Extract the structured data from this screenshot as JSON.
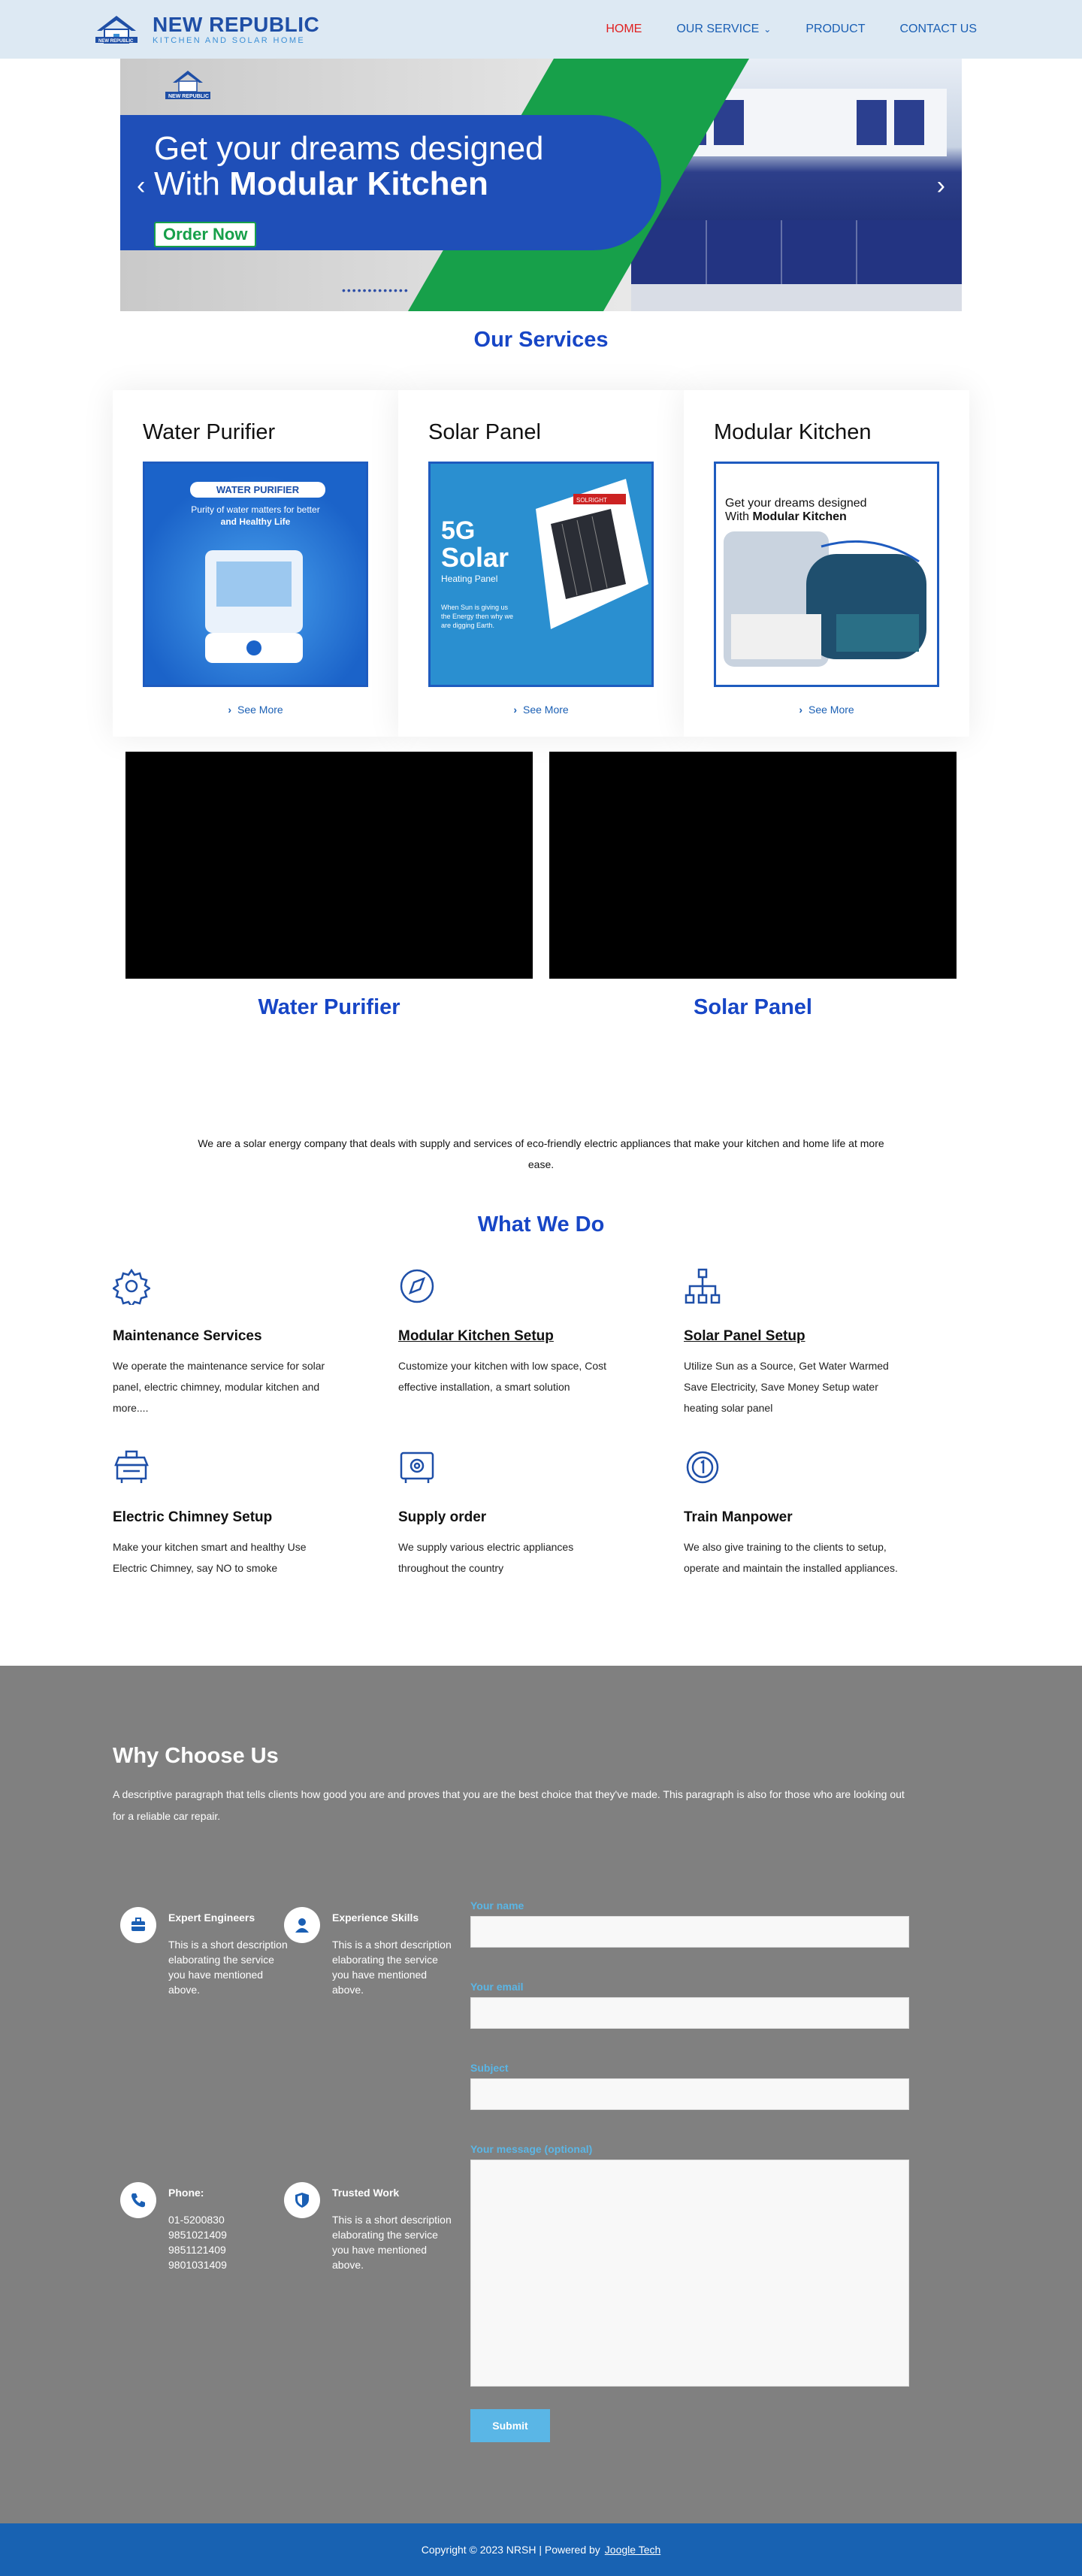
{
  "header": {
    "brand_title": "NEW REPUBLIC",
    "brand_sub": "KITCHEN AND SOLAR HOME",
    "nav": [
      {
        "label": "HOME",
        "active": true
      },
      {
        "label": "OUR SERVICE",
        "dropdown": true
      },
      {
        "label": "PRODUCT"
      },
      {
        "label": "CONTACT US"
      }
    ]
  },
  "banner": {
    "line1": "Get your dreams designed",
    "line2_prefix": "With ",
    "line2_bold": "Modular Kitchen",
    "cta": "Order Now",
    "logo_title": "NEW REPUBLIC",
    "prev_icon": "chevron-left-icon",
    "next_icon": "chevron-right-icon"
  },
  "services": {
    "title": "Our Services",
    "cards": [
      {
        "title": "Water Purifier",
        "see_more": "See More",
        "img_badge": "WATER PURIFIER",
        "img_line1": "Purity of water matters for better",
        "img_line2": "and Healthy Life"
      },
      {
        "title": "Solar Panel",
        "see_more": "See More",
        "img_big": "5G",
        "img_big2": "Solar",
        "img_sub": "Heating Panel",
        "img_note": "When Sun is giving us the Energy then why we are digging Earth.",
        "img_brand": "SOLRIGHT"
      },
      {
        "title": "Modular Kitchen",
        "see_more": "See More",
        "img_line1": "Get your dreams designed",
        "img_line2_prefix": "With ",
        "img_line2_bold": "Modular Kitchen"
      }
    ]
  },
  "videos": {
    "labels": [
      "Water Purifier",
      "Solar Panel"
    ]
  },
  "about": "We are a solar energy company that deals with supply and services of eco-friendly electric appliances that make your kitchen and home life at more ease.",
  "what_we_do": {
    "title": "What We Do",
    "items": [
      {
        "icon": "gear-icon",
        "title": "Maintenance Services",
        "underline": false,
        "text": "We operate the maintenance service for solar panel, electric chimney, modular kitchen and more...."
      },
      {
        "icon": "compass-icon",
        "title": "Modular Kitchen Setup",
        "underline": true,
        "text": "Customize your kitchen with low space, Cost effective installation, a smart solution"
      },
      {
        "icon": "sitemap-icon",
        "title": "Solar Panel Setup",
        "underline": true,
        "text": "Utilize Sun as a Source, Get Water Warmed Save Electricity, Save Money Setup water heating solar panel"
      },
      {
        "icon": "chimney-icon",
        "title": "Electric Chimney Setup",
        "underline": false,
        "text": "Make your kitchen smart and healthy Use Electric Chimney, say NO to smoke"
      },
      {
        "icon": "safe-icon",
        "title": "Supply order",
        "underline": false,
        "text": "We supply various electric appliances throughout the country"
      },
      {
        "icon": "coin-icon",
        "title": "Train Manpower",
        "underline": false,
        "text": "We also give training to the clients to setup, operate and maintain the installed appliances."
      }
    ]
  },
  "why": {
    "title": "Why Choose Us",
    "desc": "A descriptive paragraph that tells clients how good you are and proves that you are the best choice that they've made. This paragraph is also for those who are looking out for a reliable car repair.",
    "features": [
      {
        "icon": "briefcase-icon",
        "title": "Expert Engineers",
        "text": "This is a short description elaborating the service you have mentioned above."
      },
      {
        "icon": "user-icon",
        "title": "Experience Skills",
        "text": "This is a short description elaborating the service you have mentioned above."
      },
      {
        "icon": "phone-icon",
        "title": "Phone:",
        "text": "01-5200830\n9851021409\n9851121409\n9801031409"
      },
      {
        "icon": "shield-icon",
        "title": "Trusted Work",
        "text": "This is a short description elaborating the service you have mentioned above."
      }
    ],
    "form": {
      "name_label": "Your name",
      "email_label": "Your email",
      "subject_label": "Subject",
      "message_label": "Your message (optional)",
      "submit": "Submit"
    }
  },
  "footer": {
    "text": "Copyright © 2023 NRSH | Powered by",
    "link": "Joogle Tech"
  }
}
